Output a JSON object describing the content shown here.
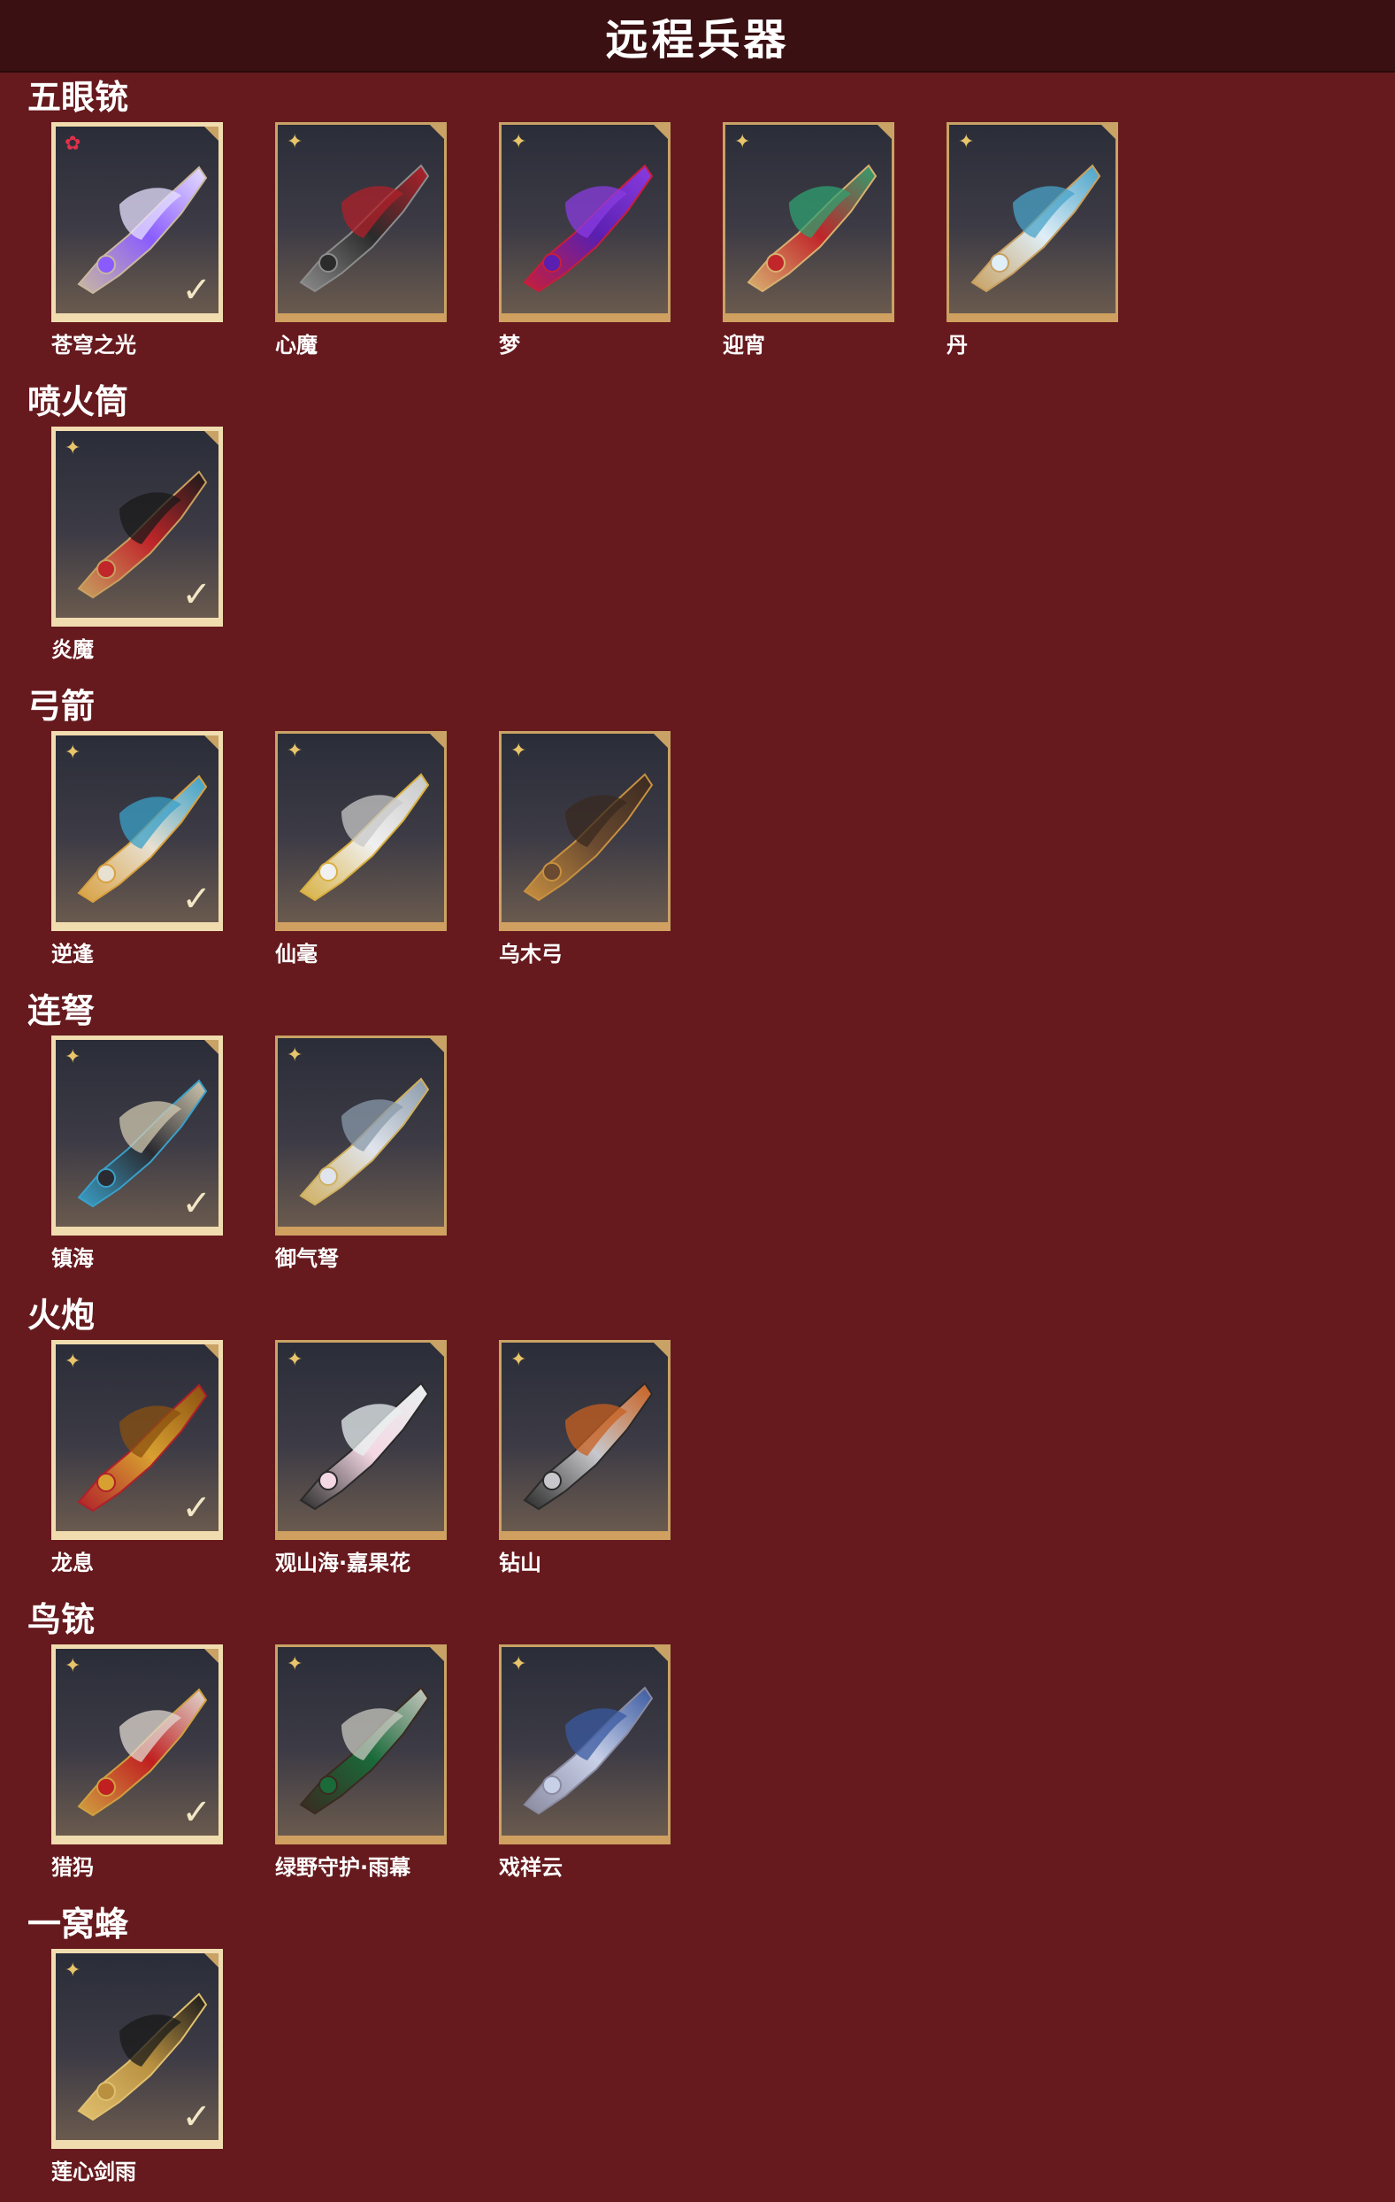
{
  "title": "远程兵器",
  "colors": {
    "background": "#661a1e",
    "title_bar": "#3a1012",
    "card_border": "#c9a265",
    "selected_border": "#f1dcb0"
  },
  "categories": [
    {
      "name": "五眼铳",
      "items": [
        {
          "label": "苍穹之光",
          "grade_icon": "red-star-icon",
          "selected": true,
          "art": [
            "#8a5cff",
            "#e7e0ff",
            "#c9b8a0"
          ]
        },
        {
          "label": "心魔",
          "grade_icon": "gold-star-icon",
          "selected": false,
          "art": [
            "#2b2b2b",
            "#b0202a",
            "#8c8c8c"
          ]
        },
        {
          "label": "梦",
          "grade_icon": "gold-star-icon",
          "selected": false,
          "art": [
            "#5a1fb0",
            "#8a3ce0",
            "#c81e3a"
          ]
        },
        {
          "label": "迎宵",
          "grade_icon": "gold-star-icon",
          "selected": false,
          "art": [
            "#c0262a",
            "#2fa070",
            "#d8b070"
          ]
        },
        {
          "label": "丹",
          "grade_icon": "gold-star-icon",
          "selected": false,
          "art": [
            "#dfeef7",
            "#4aa3c8",
            "#c8a060"
          ]
        }
      ]
    },
    {
      "name": "喷火筒",
      "items": [
        {
          "label": "炎魔",
          "grade_icon": "gold-star-icon",
          "selected": true,
          "art": [
            "#c0262a",
            "#1a1a1a",
            "#c8a060"
          ]
        }
      ]
    },
    {
      "name": "弓箭",
      "items": [
        {
          "label": "逆逢",
          "grade_icon": "gold-star-icon",
          "selected": true,
          "art": [
            "#e8e0d0",
            "#3aa0c8",
            "#d8a040"
          ]
        },
        {
          "label": "仙毫",
          "grade_icon": "gold-star-icon",
          "selected": false,
          "art": [
            "#f0f0f0",
            "#c8c8c8",
            "#d8b040"
          ]
        },
        {
          "label": "乌木弓",
          "grade_icon": "gold-star-icon",
          "selected": false,
          "art": [
            "#6a4a30",
            "#3a2a20",
            "#c89040"
          ]
        }
      ]
    },
    {
      "name": "连弩",
      "items": [
        {
          "label": "镇海",
          "grade_icon": "gold-star-icon",
          "selected": true,
          "art": [
            "#2a2a30",
            "#d0c8b0",
            "#3aa0c8"
          ]
        },
        {
          "label": "御气弩",
          "grade_icon": "gold-star-icon",
          "selected": false,
          "art": [
            "#e0e4ec",
            "#8a9aaa",
            "#d0b060"
          ]
        }
      ]
    },
    {
      "name": "火炮",
      "items": [
        {
          "label": "龙息",
          "grade_icon": "gold-star-icon",
          "selected": true,
          "art": [
            "#d8a030",
            "#8a5010",
            "#b0202a"
          ]
        },
        {
          "label": "观山海·嘉果花",
          "grade_icon": "gold-star-icon",
          "selected": false,
          "art": [
            "#f4d8e4",
            "#e8f0f0",
            "#2a2a2a"
          ]
        },
        {
          "label": "钻山",
          "grade_icon": "gold-star-icon",
          "selected": false,
          "art": [
            "#c8c8cc",
            "#c86020",
            "#2a2a2a"
          ]
        }
      ]
    },
    {
      "name": "鸟铳",
      "items": [
        {
          "label": "猎犸",
          "grade_icon": "gold-star-icon",
          "selected": true,
          "art": [
            "#c02020",
            "#e0d8d0",
            "#d0a040"
          ]
        },
        {
          "label": "绿野守护·雨幕",
          "grade_icon": "gold-star-icon",
          "selected": false,
          "art": [
            "#1a6a3a",
            "#c8c8c0",
            "#3a2a20"
          ]
        },
        {
          "label": "戏祥云",
          "grade_icon": "gold-star-icon",
          "selected": false,
          "art": [
            "#c8d0e8",
            "#3a5aa0",
            "#8a8aa0"
          ]
        }
      ]
    },
    {
      "name": "一窝蜂",
      "items": [
        {
          "label": "莲心剑雨",
          "grade_icon": "gold-star-icon",
          "selected": true,
          "art": [
            "#b89040",
            "#1a1a1a",
            "#e0c070"
          ]
        }
      ]
    }
  ],
  "icons": {
    "selected_check": "check-icon",
    "corner": "corner-tab-icon"
  }
}
